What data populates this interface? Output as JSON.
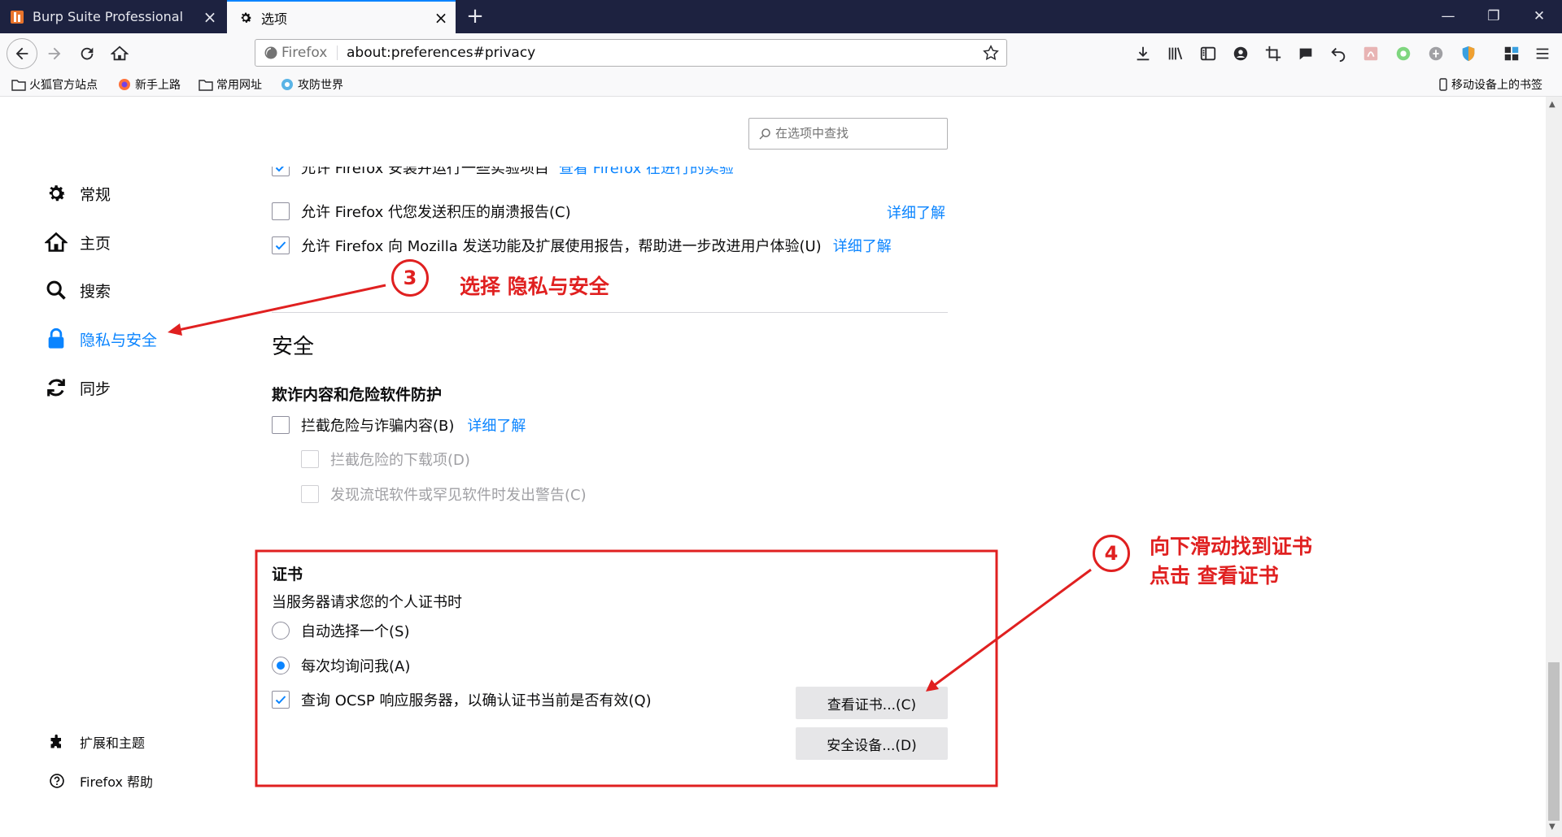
{
  "tabs": [
    {
      "label": "Burp Suite Professional",
      "close": "×"
    },
    {
      "label": "选项",
      "close": "×"
    }
  ],
  "newtab": "+",
  "window": {
    "minimize": "—",
    "restore": "❐",
    "close": "✕"
  },
  "urlbar": {
    "brand": "Firefox",
    "url": "about:preferences#privacy"
  },
  "bookmarks": [
    {
      "label": "火狐官方站点"
    },
    {
      "label": "新手上路"
    },
    {
      "label": "常用网址"
    },
    {
      "label": "攻防世界"
    }
  ],
  "mobile_bookmarks": "移动设备上的书签",
  "search": {
    "placeholder": "在选项中查找"
  },
  "sidebar": {
    "categories": [
      {
        "label": "常规"
      },
      {
        "label": "主页"
      },
      {
        "label": "搜索"
      },
      {
        "label": "隐私与安全"
      },
      {
        "label": "同步"
      }
    ],
    "footer": [
      {
        "label": "扩展和主题"
      },
      {
        "label": "Firefox 帮助"
      }
    ]
  },
  "data_collection": {
    "cut_row": "允许 Firefox 安装并运行一些实验项目",
    "cut_link": "查看 Firefox 在进行的实验",
    "crash_reports": "允许 Firefox 代您发送积压的崩溃报告(C)",
    "crash_link": "详细了解",
    "telemetry": "允许 Firefox 向 Mozilla 发送功能及扩展使用报告，帮助进一步改进用户体验(U)",
    "telemetry_link": "详细了解"
  },
  "security": {
    "title": "安全",
    "subtitle": "欺诈内容和危险软件防护",
    "block_dangerous": "拦截危险与诈骗内容(B)",
    "learn_more": "详细了解",
    "block_downloads": "拦截危险的下载项(D)",
    "warn_unwanted": "发现流氓软件或罕见软件时发出警告(C)"
  },
  "certificates": {
    "title": "证书",
    "desc": "当服务器请求您的个人证书时",
    "auto_select": "自动选择一个(S)",
    "ask_every": "每次均询问我(A)",
    "ocsp": "查询 OCSP 响应服务器，以确认证书当前是否有效(Q)",
    "view_certs": "查看证书...(C)",
    "security_devices": "安全设备...(D)"
  },
  "annotations": {
    "step3_num": "3",
    "step3_text": "选择 隐私与安全",
    "step4_num": "4",
    "step4_line1": "向下滑动找到证书",
    "step4_line2": "点击 查看证书"
  },
  "colors": {
    "accent": "#0a84ff",
    "annotation": "#e02020",
    "titlebar": "#1d2240"
  }
}
